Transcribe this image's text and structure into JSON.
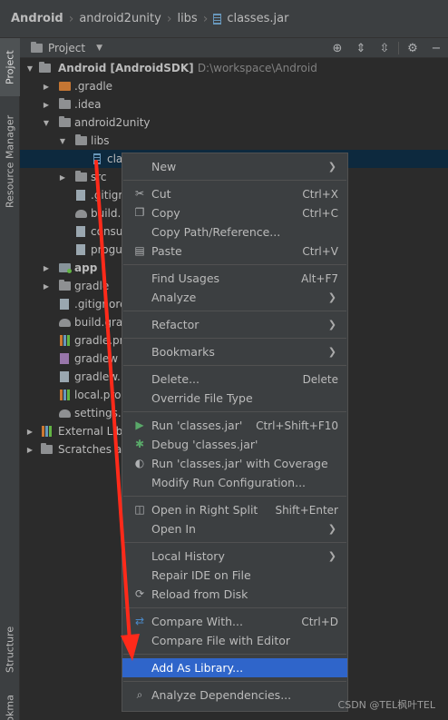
{
  "breadcrumb": {
    "items": [
      "Android",
      "android2unity",
      "libs",
      "classes.jar"
    ]
  },
  "side_tabs": {
    "project": "Project",
    "resource_manager": "Resource Manager",
    "structure": "Structure",
    "bookmarks": "Bookmarks"
  },
  "panel": {
    "title": "Project",
    "tool_icons": [
      "locate-icon",
      "expand-all-icon",
      "collapse-all-icon",
      "gear-icon",
      "hide-icon"
    ]
  },
  "tree": {
    "root_name": "Android [AndroidSDK]",
    "root_path": "D:\\workspace\\Android",
    "rows": [
      {
        "label": "Android [AndroidSDK]",
        "icon": "folder-icon"
      },
      {
        "label": ".gradle",
        "icon": "folder-orange-icon"
      },
      {
        "label": ".idea",
        "icon": "folder-icon"
      },
      {
        "label": "android2unity",
        "icon": "folder-icon"
      },
      {
        "label": "libs",
        "icon": "folder-icon"
      },
      {
        "label": "cla",
        "icon": "jar-icon"
      },
      {
        "label": "src",
        "icon": "folder-icon"
      },
      {
        "label": ".gitigr",
        "icon": "file-icon"
      },
      {
        "label": "build.",
        "icon": "gradle-icon"
      },
      {
        "label": "consu",
        "icon": "file-icon"
      },
      {
        "label": "progu",
        "icon": "file-icon"
      },
      {
        "label": "app",
        "icon": "module-icon"
      },
      {
        "label": "gradle",
        "icon": "folder-icon"
      },
      {
        "label": ".gitignore",
        "icon": "file-icon"
      },
      {
        "label": "build.gra",
        "icon": "gradle-icon"
      },
      {
        "label": "gradle.pr",
        "icon": "properties-icon"
      },
      {
        "label": "gradlew",
        "icon": "shell-icon"
      },
      {
        "label": "gradlew.",
        "icon": "file-icon"
      },
      {
        "label": "local.pro",
        "icon": "properties-icon"
      },
      {
        "label": "settings.g",
        "icon": "gradle-icon"
      },
      {
        "label": "External Libr",
        "icon": "library-icon"
      },
      {
        "label": "Scratches ar",
        "icon": "scratch-icon"
      }
    ]
  },
  "menu": {
    "new": "New",
    "cut": "Cut",
    "cut_sc": "Ctrl+X",
    "copy": "Copy",
    "copy_sc": "Ctrl+C",
    "copy_path": "Copy Path/Reference...",
    "paste": "Paste",
    "paste_sc": "Ctrl+V",
    "find_usages": "Find Usages",
    "find_usages_sc": "Alt+F7",
    "analyze": "Analyze",
    "refactor": "Refactor",
    "bookmarks": "Bookmarks",
    "delete": "Delete...",
    "delete_sc": "Delete",
    "override_type": "Override File Type",
    "run": "Run 'classes.jar'",
    "run_sc": "Ctrl+Shift+F10",
    "debug": "Debug 'classes.jar'",
    "run_coverage": "Run 'classes.jar' with Coverage",
    "modify_run": "Modify Run Configuration...",
    "open_right": "Open in Right Split",
    "open_right_sc": "Shift+Enter",
    "open_in": "Open In",
    "local_history": "Local History",
    "repair_ide": "Repair IDE on File",
    "reload": "Reload from Disk",
    "compare_with": "Compare With...",
    "compare_with_sc": "Ctrl+D",
    "compare_editor": "Compare File with Editor",
    "add_library": "Add As Library...",
    "analyze_deps": "Analyze Dependencies..."
  },
  "watermark": "CSDN @TEL枫叶TEL",
  "colors": {
    "background": "#2b2b2b",
    "menu_bg": "#3c3f41",
    "highlight": "#2f65ca",
    "selection": "#0d293e",
    "annotation_arrow": "#ff2a1a"
  }
}
